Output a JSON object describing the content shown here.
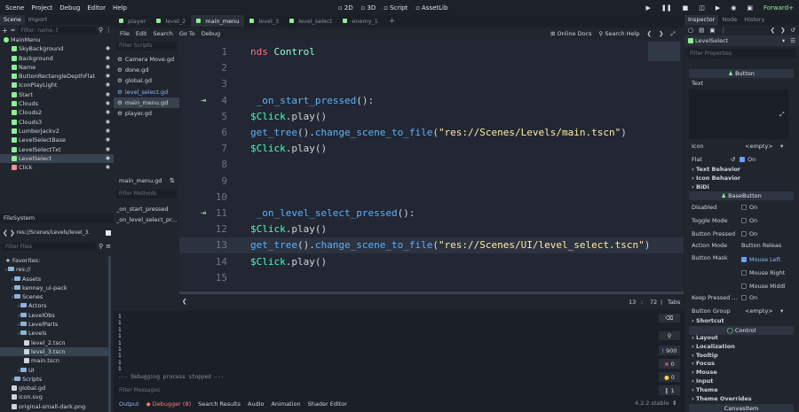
{
  "menu": [
    "Scene",
    "Project",
    "Debug",
    "Editor",
    "Help"
  ],
  "workspaces": [
    {
      "label": "2D"
    },
    {
      "label": "3D"
    },
    {
      "label": "Script",
      "active": true
    },
    {
      "label": "AssetLib"
    }
  ],
  "renderer": "Forward+",
  "scene_tabs": [
    {
      "label": "player"
    },
    {
      "label": "level_2"
    },
    {
      "label": "main_menu",
      "active": true
    },
    {
      "label": "level_3"
    },
    {
      "label": "level_select"
    },
    {
      "label": "enemy_1"
    }
  ],
  "scene_dock": {
    "tabs": [
      {
        "label": "Scene",
        "active": true
      },
      {
        "label": "Import"
      }
    ],
    "filter_placeholder": "Filter: name, t",
    "nodes": [
      {
        "name": "MainMenu",
        "color": "#8eef97",
        "indent": 0
      },
      {
        "name": "SkyBackground",
        "color": "#8eef97",
        "indent": 1
      },
      {
        "name": "Background",
        "color": "#8eef97",
        "indent": 1
      },
      {
        "name": "Name",
        "color": "#8eef97",
        "indent": 1
      },
      {
        "name": "ButtonRectangleDepthFlat",
        "color": "#8eef97",
        "indent": 1
      },
      {
        "name": "IconPlayLight",
        "color": "#8eef97",
        "indent": 1
      },
      {
        "name": "Start",
        "color": "#8eef97",
        "indent": 1
      },
      {
        "name": "Clouds",
        "color": "#8eef97",
        "indent": 1
      },
      {
        "name": "Clouds2",
        "color": "#8eef97",
        "indent": 1
      },
      {
        "name": "Clouds3",
        "color": "#8eef97",
        "indent": 1
      },
      {
        "name": "Lumberjackv2",
        "color": "#8eef97",
        "indent": 1
      },
      {
        "name": "LevelSelectBase",
        "color": "#8eef97",
        "indent": 1
      },
      {
        "name": "LevelSelectTxt",
        "color": "#8eef97",
        "indent": 1
      },
      {
        "name": "LevelSelect",
        "color": "#8eef97",
        "indent": 1,
        "selected": true
      },
      {
        "name": "Click",
        "color": "#ff8f8f",
        "indent": 1
      }
    ]
  },
  "filesystem": {
    "title": "FileSystem",
    "path": "res://Scenes/Levels/level_3.",
    "filter_placeholder": "Filter Files",
    "items": [
      {
        "name": "Favorites:",
        "indent": 0,
        "type": "fav"
      },
      {
        "name": "res://",
        "indent": 0,
        "type": "folder"
      },
      {
        "name": "Assets",
        "indent": 1,
        "type": "folder"
      },
      {
        "name": "kenney_ui-pack",
        "indent": 1,
        "type": "folder"
      },
      {
        "name": "Scenes",
        "indent": 1,
        "type": "folder"
      },
      {
        "name": "Actors",
        "indent": 2,
        "type": "folder"
      },
      {
        "name": "LevelObs",
        "indent": 2,
        "type": "folder"
      },
      {
        "name": "LevelParts",
        "indent": 2,
        "type": "folder"
      },
      {
        "name": "Levels",
        "indent": 2,
        "type": "folder"
      },
      {
        "name": "level_2.tscn",
        "indent": 3,
        "type": "file"
      },
      {
        "name": "level_3.tscn",
        "indent": 3,
        "type": "file",
        "selected": true
      },
      {
        "name": "main.tscn",
        "indent": 3,
        "type": "file"
      },
      {
        "name": "UI",
        "indent": 2,
        "type": "folder"
      },
      {
        "name": "Scripts",
        "indent": 1,
        "type": "folder"
      },
      {
        "name": "global.gd",
        "indent": 1,
        "type": "file"
      },
      {
        "name": "icon.svg",
        "indent": 1,
        "type": "file"
      },
      {
        "name": "original-small-dark.png",
        "indent": 1,
        "type": "file"
      }
    ]
  },
  "script_menu": [
    "File",
    "Edit",
    "Search",
    "Go To",
    "Debug"
  ],
  "script_toolbar": {
    "online_docs": "Online Docs",
    "search_help": "Search Help"
  },
  "scripts": {
    "filter_placeholder": "Filter Scripts",
    "files": [
      {
        "name": "Camera Move.gd"
      },
      {
        "name": "done.gd"
      },
      {
        "name": "global.gd"
      },
      {
        "name": "level_select.gd",
        "highlight": true
      },
      {
        "name": "main_menu.gd",
        "selected": true
      },
      {
        "name": "player.gd"
      }
    ],
    "current": "main_menu.gd",
    "methods_placeholder": "Filter Methods",
    "methods": [
      "_on_start_pressed",
      "_on_level_select_pr..."
    ]
  },
  "code_lines": [
    {
      "n": "1",
      "tokens": [
        [
          "kw",
          "nds "
        ],
        [
          "ty",
          "Control"
        ]
      ]
    },
    {
      "n": "2",
      "tokens": []
    },
    {
      "n": "3",
      "tokens": []
    },
    {
      "n": "4",
      "marker": true,
      "tokens": [
        [
          "fn",
          " _on_start_pressed"
        ],
        [
          "",
          "():"
        ]
      ]
    },
    {
      "n": "5",
      "tokens": [
        [
          "nd",
          "$Click"
        ],
        [
          "",
          ".play()"
        ]
      ]
    },
    {
      "n": "6",
      "tokens": [
        [
          "fn",
          "get_tree"
        ],
        [
          "",
          "()."
        ],
        [
          "fn",
          "change_scene_to_file"
        ],
        [
          "",
          "("
        ],
        [
          "str",
          "\"res://Scenes/Levels/main.tscn\""
        ],
        [
          "",
          ")"
        ]
      ]
    },
    {
      "n": "7",
      "tokens": [
        [
          "nd",
          "$Click"
        ],
        [
          "",
          ".play()"
        ]
      ]
    },
    {
      "n": "8",
      "tokens": []
    },
    {
      "n": "9",
      "tokens": []
    },
    {
      "n": "10",
      "tokens": []
    },
    {
      "n": "11",
      "marker": true,
      "tokens": [
        [
          "fn",
          " _on_level_select_pressed"
        ],
        [
          "",
          "():"
        ]
      ]
    },
    {
      "n": "12",
      "tokens": [
        [
          "nd",
          "$Click"
        ],
        [
          "",
          ".play()"
        ]
      ]
    },
    {
      "n": "13",
      "current": true,
      "tokens": [
        [
          "fn",
          "get_tree"
        ],
        [
          "",
          "()."
        ],
        [
          "fn",
          "change_scene_to_file"
        ],
        [
          "",
          "("
        ],
        [
          "str",
          "\"res://Scenes/UI/level_select.tscn\""
        ],
        [
          "",
          ")"
        ]
      ]
    },
    {
      "n": "14",
      "tokens": [
        [
          "nd",
          "$Click"
        ],
        [
          "",
          ".play()"
        ]
      ]
    },
    {
      "n": "15",
      "tokens": []
    }
  ],
  "editor_status": {
    "line": "13",
    "col": "72",
    "indent": "Tabs"
  },
  "output": {
    "lines": [
      "1",
      "1",
      "1",
      "1",
      "1",
      "1",
      "1",
      "1",
      "1"
    ],
    "stopped": "--- Debugging process stopped ---",
    "filter_placeholder": "Filter Messages",
    "counts": {
      "all": "900",
      "errors": "0",
      "warnings": "0",
      "info": "1"
    }
  },
  "bottom_tabs": [
    {
      "label": "Output",
      "active": true
    },
    {
      "label": "Debugger (8)",
      "warn": true
    },
    {
      "label": "Search Results"
    },
    {
      "label": "Audio"
    },
    {
      "label": "Animation"
    },
    {
      "label": "Shader Editor"
    }
  ],
  "version": "4.2.2.stable",
  "inspector": {
    "tabs": [
      {
        "label": "Inspector",
        "active": true
      },
      {
        "label": "Node"
      },
      {
        "label": "History"
      }
    ],
    "object": "LevelSelect",
    "filter_placeholder": "Filter Properties",
    "sections": {
      "button": "Button",
      "basebutton": "BaseButton",
      "control": "Control",
      "canvas": "CanvasItem"
    },
    "text_label": "Text",
    "icon": {
      "label": "Icon",
      "value": "<empty>"
    },
    "flat": {
      "label": "Flat",
      "value": "On"
    },
    "groups1": [
      "Text Behavior",
      "Icon Behavior",
      "BiDi"
    ],
    "base": [
      {
        "label": "Disabled",
        "value": "On",
        "on": false
      },
      {
        "label": "Toggle Mode",
        "value": "On",
        "on": false
      },
      {
        "label": "Button Pressed",
        "value": "On",
        "on": false
      }
    ],
    "action_mode": {
      "label": "Action Mode",
      "value": "Button Releas"
    },
    "button_mask": {
      "label": "Button Mask",
      "items": [
        {
          "label": "Mouse Left",
          "on": true
        },
        {
          "label": "Mouse Right",
          "on": false
        },
        {
          "label": "Mouse Middl",
          "on": false
        }
      ]
    },
    "keep_pressed": {
      "label": "Keep Pressed ...",
      "value": "On"
    },
    "button_group": {
      "label": "Button Group",
      "value": "<empty>"
    },
    "shortcut": "Shortcut",
    "control_groups": [
      "Layout",
      "Localization",
      "Tooltip",
      "Focus",
      "Mouse",
      "Input",
      "Theme",
      "Theme Overrides"
    ]
  }
}
